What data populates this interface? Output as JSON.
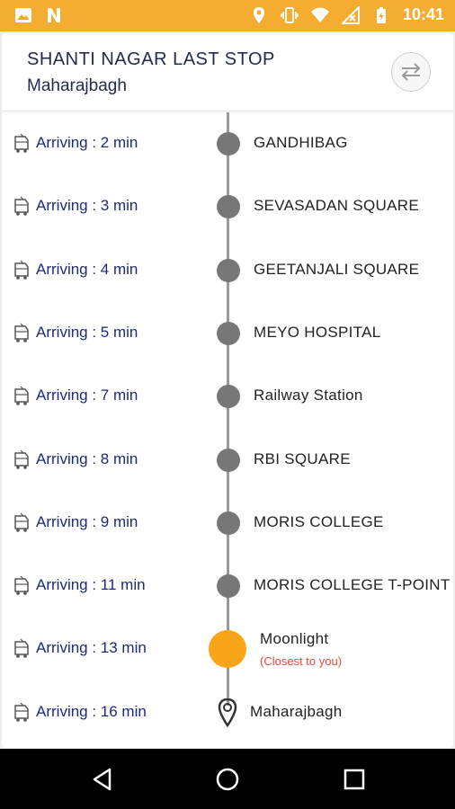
{
  "status_bar": {
    "time": "10:41",
    "left_icons": [
      "image-icon",
      "notification-n-icon"
    ],
    "right_icons": [
      "location-icon",
      "vibrate-icon",
      "wifi-icon",
      "no-signal-icon",
      "battery-charging-icon"
    ]
  },
  "header": {
    "title": "SHANTI NAGAR LAST STOP",
    "subtitle": "Maharajbagh",
    "swap_icon": "swap-icon"
  },
  "stops": [
    {
      "arrival": "Arriving : 2 min",
      "name": "GANDHIBAG",
      "marker": "dot"
    },
    {
      "arrival": "Arriving : 3 min",
      "name": "SEVASADAN SQUARE",
      "marker": "dot"
    },
    {
      "arrival": "Arriving : 4 min",
      "name": "GEETANJALI SQUARE",
      "marker": "dot"
    },
    {
      "arrival": "Arriving : 5 min",
      "name": "MEYO HOSPITAL",
      "marker": "dot"
    },
    {
      "arrival": "Arriving : 7 min",
      "name": "Railway Station",
      "marker": "dot"
    },
    {
      "arrival": "Arriving : 8 min",
      "name": "RBI SQUARE",
      "marker": "dot"
    },
    {
      "arrival": "Arriving : 9 min",
      "name": "MORIS COLLEGE",
      "marker": "dot"
    },
    {
      "arrival": "Arriving : 11 min",
      "name": "MORIS COLLEGE T-POINT",
      "marker": "dot"
    },
    {
      "arrival": "Arriving : 13 min",
      "name": "Moonlight",
      "marker": "highlight",
      "note": "(Closest to you)"
    },
    {
      "arrival": "Arriving : 16 min",
      "name": "Maharajbagh",
      "marker": "pin"
    }
  ],
  "colors": {
    "accent": "#f4ad30",
    "highlight_dot": "#f9a51a",
    "arrival_text": "#1d2a7a",
    "note_text": "#e8473b",
    "dot": "#777777"
  },
  "nav_bar": {
    "buttons": [
      "back-icon",
      "home-icon",
      "recents-icon"
    ]
  }
}
